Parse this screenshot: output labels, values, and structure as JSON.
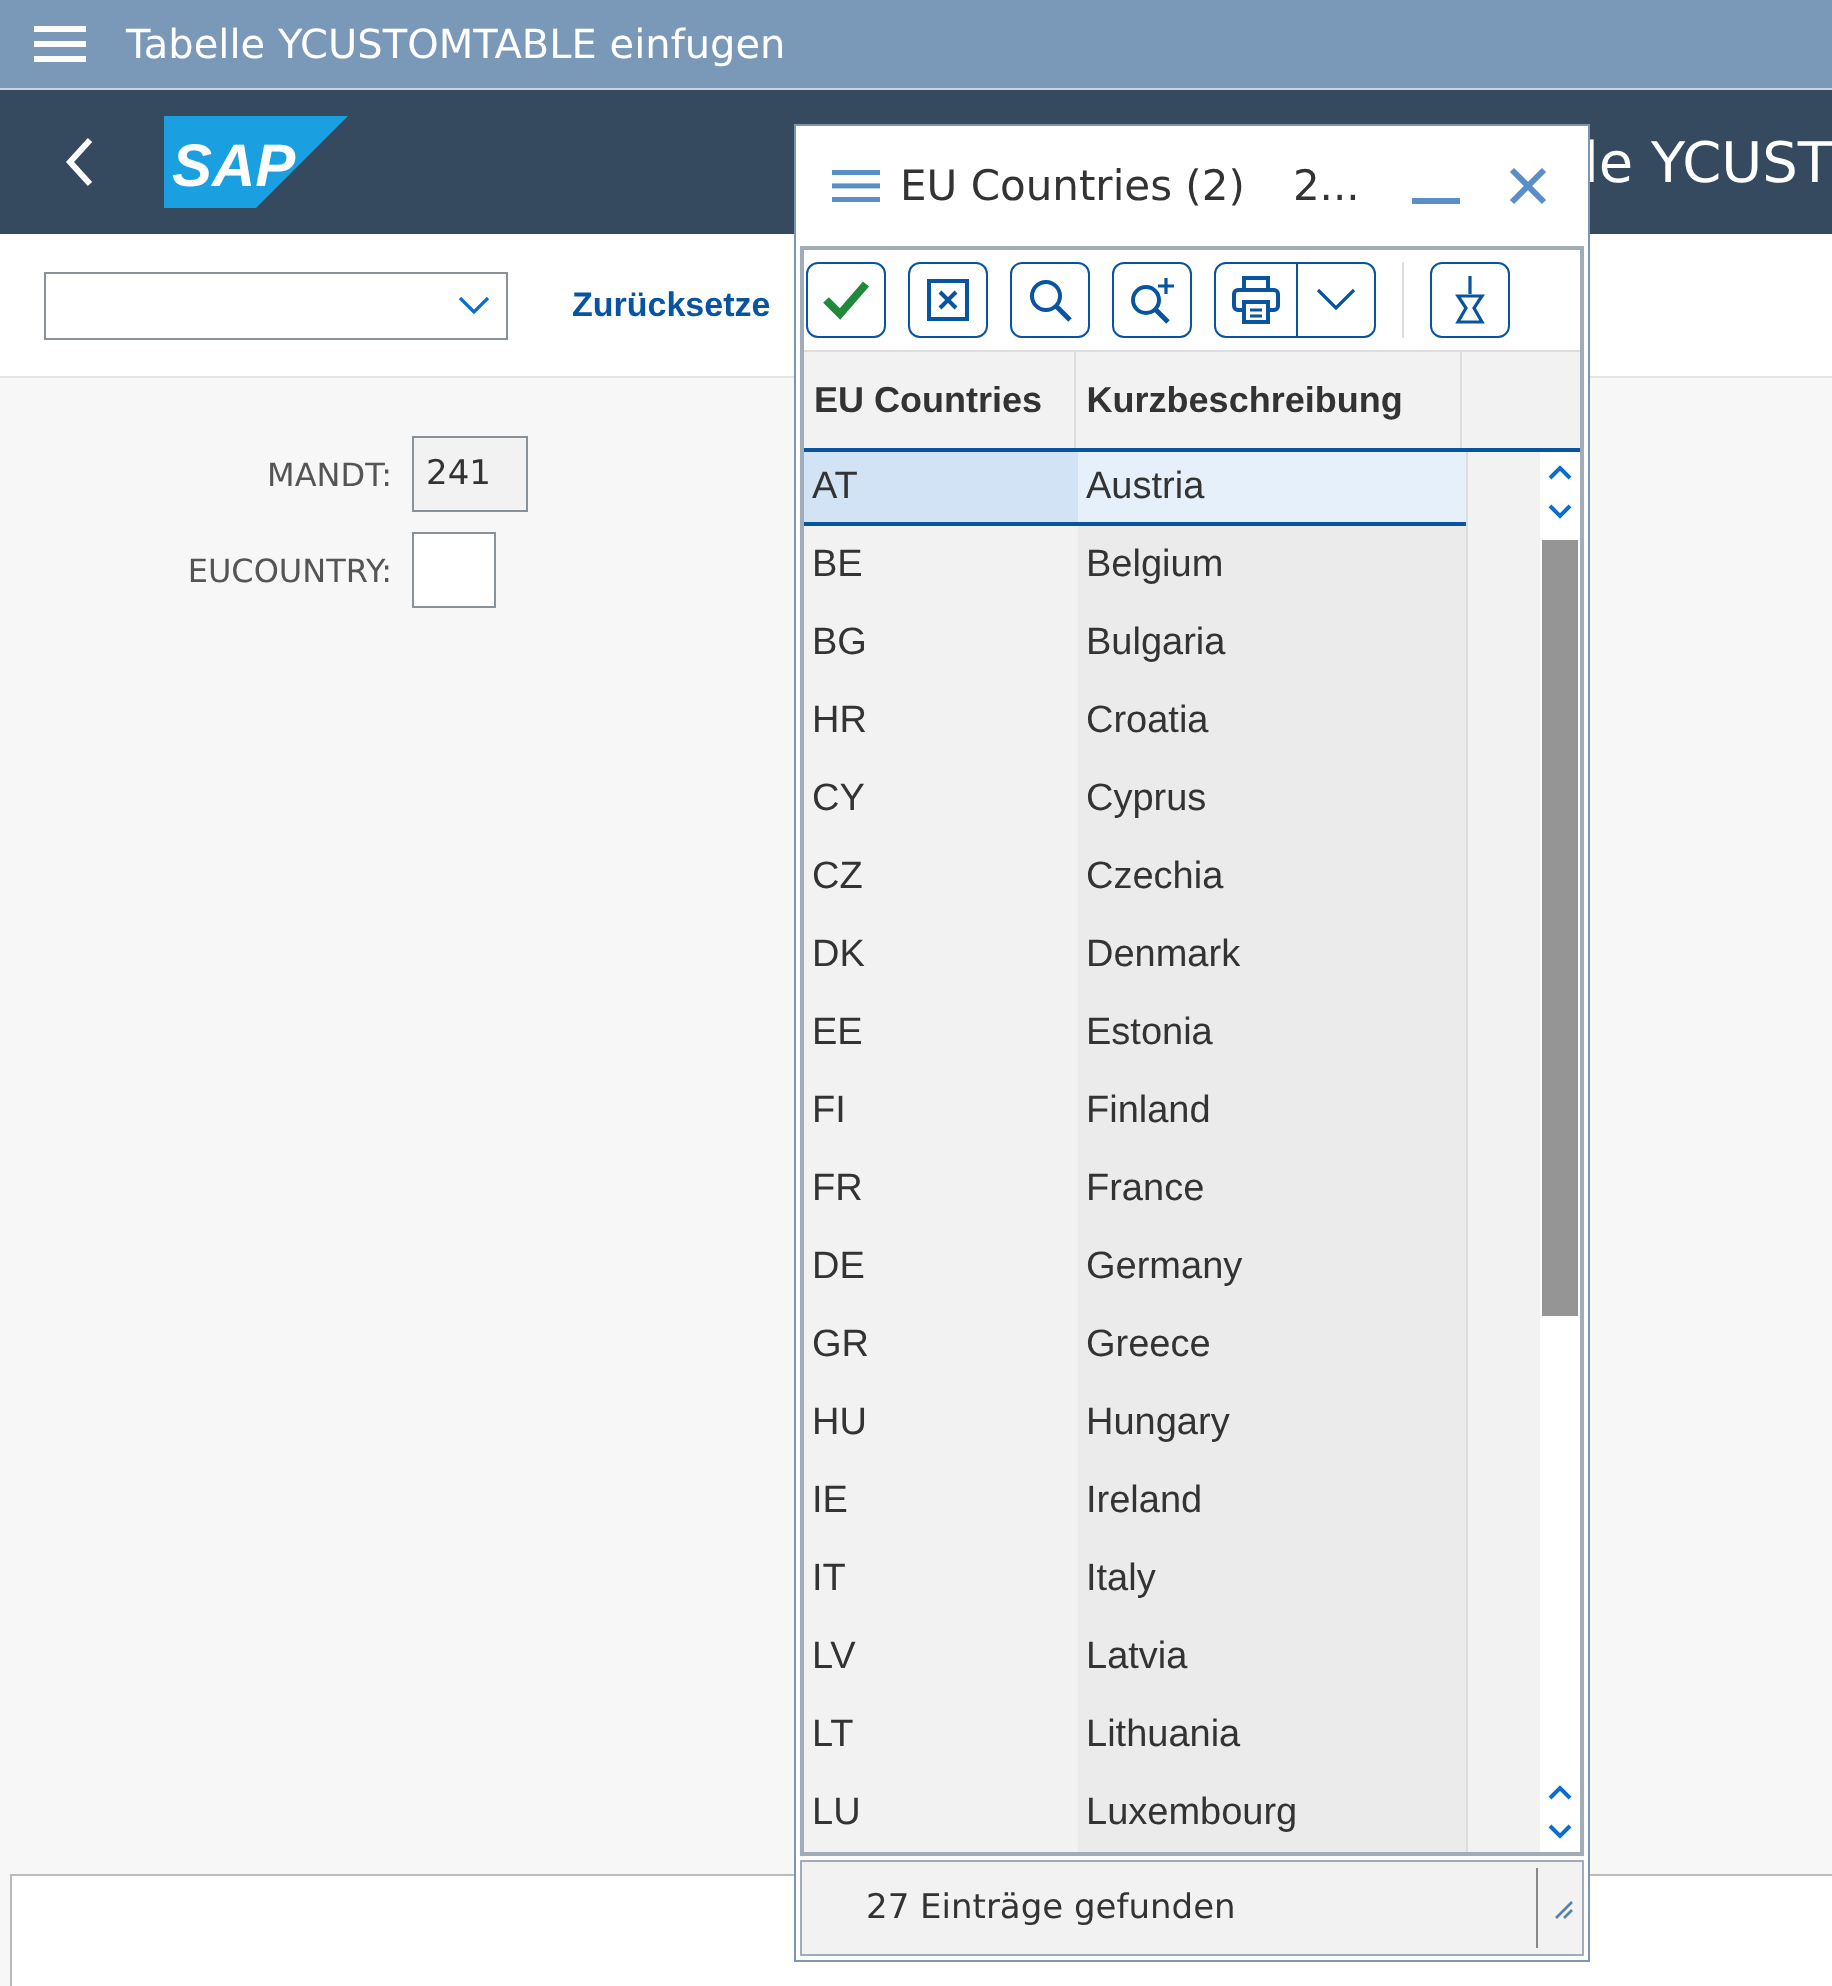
{
  "window": {
    "title": "Tabelle YCUSTOMTABLE einfugen"
  },
  "header": {
    "logo": "SAP",
    "title": "le YCUST"
  },
  "toolbar": {
    "reset_link": "Zurücksetze"
  },
  "form": [
    {
      "label": "MANDT:",
      "value": "241",
      "disabled": true
    },
    {
      "label": "EUCOUNTRY:",
      "disabled": false
    }
  ],
  "dialog": {
    "title": "EU Countries (2)",
    "subtitle": "2...",
    "columns": [
      "EU Countries",
      "Kurzbeschreibung"
    ],
    "rows": [
      {
        "code": "AT",
        "name": "Austria",
        "selected": true
      },
      {
        "code": "BE",
        "name": "Belgium",
        "selected": false
      },
      {
        "code": "BG",
        "name": "Bulgaria",
        "selected": false
      },
      {
        "code": "HR",
        "name": "Croatia",
        "selected": false
      },
      {
        "code": "CY",
        "name": "Cyprus",
        "selected": false
      },
      {
        "code": "CZ",
        "name": "Czechia",
        "selected": false
      },
      {
        "code": "DK",
        "name": "Denmark",
        "selected": false
      },
      {
        "code": "EE",
        "name": "Estonia",
        "selected": false
      },
      {
        "code": "FI",
        "name": "Finland",
        "selected": false
      },
      {
        "code": "FR",
        "name": "France",
        "selected": false
      },
      {
        "code": "DE",
        "name": "Germany",
        "selected": false
      },
      {
        "code": "GR",
        "name": "Greece",
        "selected": false
      },
      {
        "code": "HU",
        "name": "Hungary",
        "selected": false
      },
      {
        "code": "IE",
        "name": "Ireland",
        "selected": false
      },
      {
        "code": "IT",
        "name": "Italy",
        "selected": false
      },
      {
        "code": "LV",
        "name": "Latvia",
        "selected": false
      },
      {
        "code": "LT",
        "name": "Lithuania",
        "selected": false
      },
      {
        "code": "LU",
        "name": "Luxembourg",
        "selected": false
      }
    ],
    "status": "27 Einträge gefunden"
  }
}
